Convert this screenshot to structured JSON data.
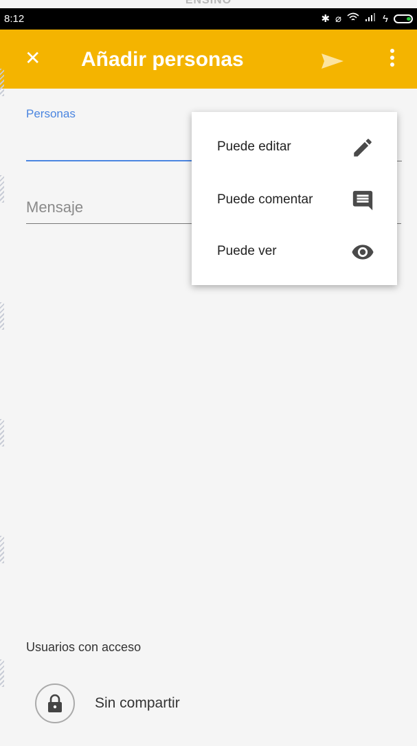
{
  "header_strip": {
    "text": "ENSINO"
  },
  "status_bar": {
    "time": "8:12",
    "icons": [
      "bluetooth-icon",
      "mute-icon",
      "wifi-icon",
      "signal-icon",
      "charging-icon",
      "battery-icon"
    ]
  },
  "app_bar": {
    "title": "Añadir personas",
    "close_icon": "close-icon",
    "send_icon": "send-icon",
    "more_icon": "more-vert-icon",
    "color": "#f4b400"
  },
  "form": {
    "persons_label": "Personas",
    "persons_value": "",
    "message_placeholder": "Mensaje",
    "accent_color": "#4a85e0"
  },
  "permission_menu": {
    "items": [
      {
        "label": "Puede editar",
        "icon": "pencil-icon"
      },
      {
        "label": "Puede comentar",
        "icon": "comment-icon"
      },
      {
        "label": "Puede ver",
        "icon": "eye-icon"
      }
    ]
  },
  "access": {
    "section_label": "Usuarios con acceso",
    "status": "Sin compartir",
    "icon": "lock-icon"
  }
}
